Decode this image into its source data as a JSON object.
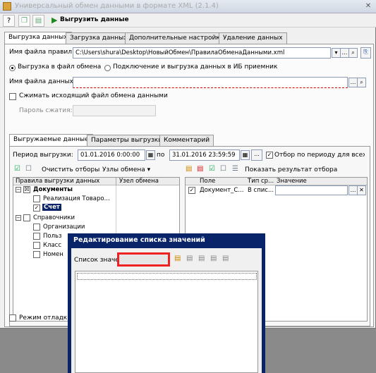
{
  "window": {
    "title": "Универсальный обмен данными в формате XML (2.1.4)"
  },
  "toolbar": {
    "help": "?",
    "export_label": "Выгрузить данные"
  },
  "main_tabs": [
    "Выгрузка данных",
    "Загрузка данных",
    "Дополнительные настройки",
    "Удаление данных"
  ],
  "rules_file": {
    "label": "Имя файла правил:",
    "value": "C:\\Users\\shura\\Desktop\\НовыйОбмен\\ПравилаОбменаДанными.xml"
  },
  "mode": {
    "option1": "Выгрузка в файл обмена",
    "option2": "Подключение и выгрузка данных в ИБ приемник"
  },
  "data_file": {
    "label": "Имя файла данных:",
    "value": ""
  },
  "compress": {
    "label": "Сжимать исходящий файл обмена данными"
  },
  "password": {
    "label": "Пароль сжатия:",
    "value": ""
  },
  "sub_tabs": [
    "Выгружаемые данные",
    "Параметры выгрузки",
    "Комментарий"
  ],
  "period": {
    "label": "Период выгрузки:",
    "from": "01.01.2016  0:00:00",
    "to_label": "по",
    "to": "31.01.2016 23:59:59",
    "ellipsis": "...",
    "filter_label": "Отбор по периоду для всех ..."
  },
  "left_toolbar": {
    "clear": "Очистить отборы",
    "nodes": "Узлы обмена ▾"
  },
  "right_toolbar": {
    "show": "Показать результат отбора"
  },
  "rules_grid": {
    "columns": [
      "Правила выгрузки данных",
      "Узел обмена"
    ],
    "rows": [
      "Документы",
      "Реализация Товаро...",
      "Счет",
      "Справочники",
      "Организации",
      "Польз",
      "Класс",
      "Номен"
    ]
  },
  "filter_grid": {
    "columns": [
      "Поле",
      "Тип ср...",
      "Значение"
    ],
    "row": {
      "field": "Документ_С...",
      "type": "В спис...",
      "value": ""
    }
  },
  "debug": {
    "label": "Режим отладки с"
  },
  "dialog": {
    "title": "Редактирование списка значений",
    "list_label": "Список значений:",
    "list_value": ""
  }
}
